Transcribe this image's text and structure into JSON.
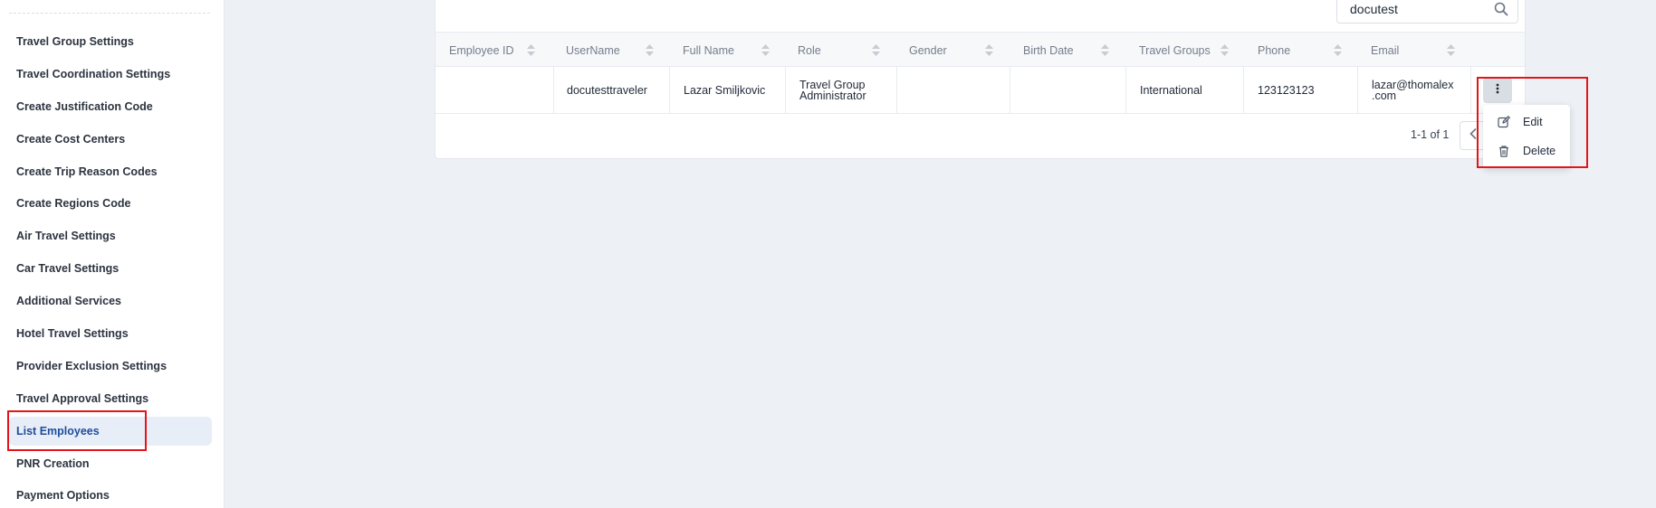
{
  "sidebar": {
    "items": [
      {
        "label": "Travel Group Settings"
      },
      {
        "label": "Travel Coordination Settings"
      },
      {
        "label": "Create Justification Code"
      },
      {
        "label": "Create Cost Centers"
      },
      {
        "label": "Create Trip Reason Codes"
      },
      {
        "label": "Create Regions Code"
      },
      {
        "label": "Air Travel Settings"
      },
      {
        "label": "Car Travel Settings"
      },
      {
        "label": "Additional Services"
      },
      {
        "label": "Hotel Travel Settings"
      },
      {
        "label": "Provider Exclusion Settings"
      },
      {
        "label": "Travel Approval Settings"
      },
      {
        "label": "List Employees",
        "active": true
      },
      {
        "label": "PNR Creation"
      },
      {
        "label": "Payment Options"
      }
    ]
  },
  "search": {
    "value": "docutest",
    "icon": "search-icon"
  },
  "table": {
    "columns": [
      "Employee ID",
      "UserName",
      "Full Name",
      "Role",
      "Gender",
      "Birth Date",
      "Travel Groups",
      "Phone",
      "Email"
    ],
    "rows": [
      {
        "employee_id": "",
        "username": "docutesttraveler",
        "full_name": "Lazar Smiljkovic",
        "role_line1": "Travel Group",
        "role_line2": "Administrator",
        "gender": "",
        "birth_date": "",
        "travel_groups": "International",
        "phone": "123123123",
        "email_line1": "lazar@thomalex",
        "email_line2": ".com"
      }
    ]
  },
  "pagination": {
    "text": "1-1 of 1"
  },
  "action_menu": {
    "edit_label": "Edit",
    "delete_label": "Delete"
  },
  "colors": {
    "highlight": "#e3151a",
    "active_bg": "#e8eef8",
    "active_text": "#1e4d9b"
  }
}
